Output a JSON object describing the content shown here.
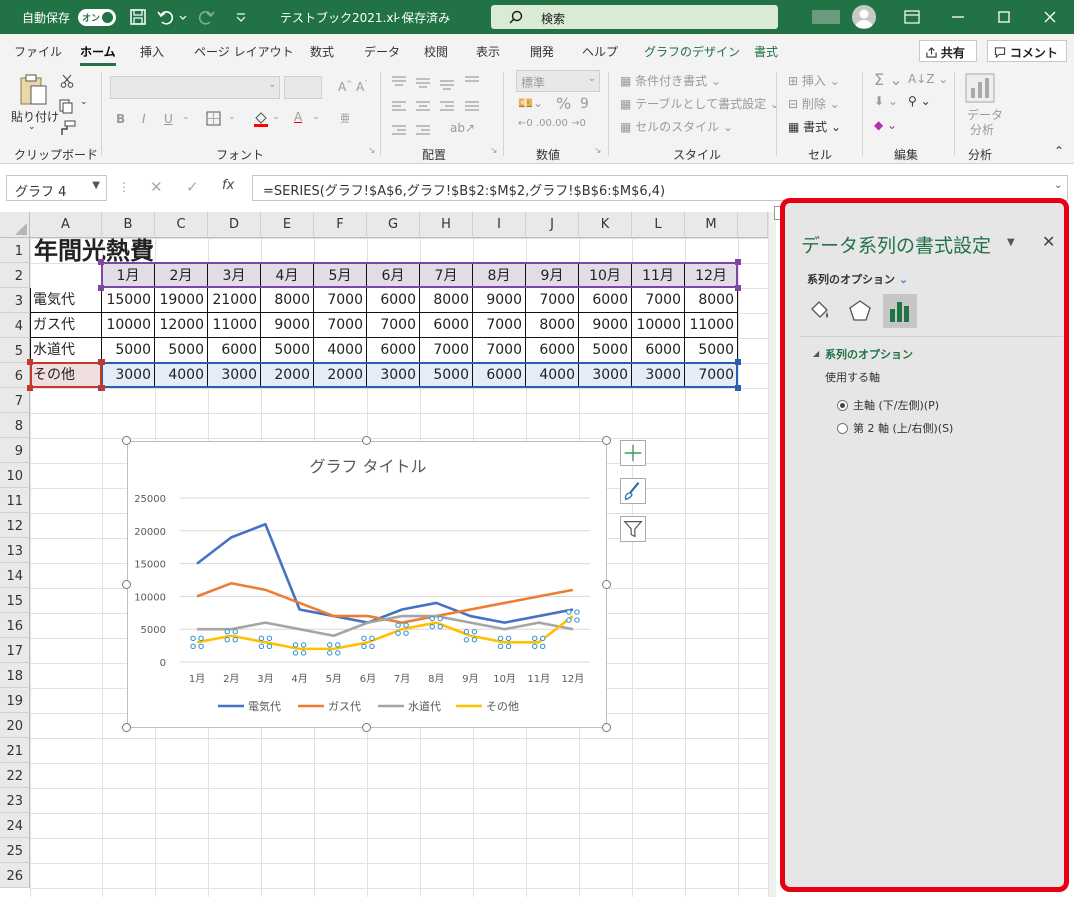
{
  "titlebar": {
    "autosave_label": "自動保存",
    "autosave_state": "オン",
    "filename": "テストブック2021.xl···",
    "save_state": "- 保存済み",
    "search_placeholder": "検索"
  },
  "tabs": [
    "ファイル",
    "ホーム",
    "挿入",
    "ページ レイアウト",
    "数式",
    "データ",
    "校閲",
    "表示",
    "開発",
    "ヘルプ",
    "グラフのデザイン",
    "書式"
  ],
  "tab_active": "ホーム",
  "share_label": "共有",
  "comment_label": "コメント",
  "ribbon": {
    "clipboard": {
      "label": "クリップボード",
      "paste": "貼り付け"
    },
    "font": {
      "label": "フォント"
    },
    "alignment": {
      "label": "配置"
    },
    "number": {
      "label": "数値",
      "format": "標準"
    },
    "styles": {
      "label": "スタイル",
      "conditional": "条件付き書式",
      "as_table": "テーブルとして書式設定",
      "cell_styles": "セルのスタイル"
    },
    "cells": {
      "label": "セル",
      "insert": "挿入",
      "delete": "削除",
      "format": "書式"
    },
    "editing": {
      "label": "編集"
    },
    "analysis": {
      "label": "分析",
      "data_analysis_1": "データ",
      "data_analysis_2": "分析"
    }
  },
  "formula_bar": {
    "name_box": "グラフ 4",
    "formula": "=SERIES(グラフ!$A$6,グラフ!$B$2:$M$2,グラフ!$B$6:$M$6,4)"
  },
  "columns": [
    "A",
    "B",
    "C",
    "D",
    "E",
    "F",
    "G",
    "H",
    "I",
    "J",
    "K",
    "L",
    "M"
  ],
  "rows": [
    "1",
    "2",
    "3",
    "4",
    "5",
    "6",
    "7",
    "8",
    "9",
    "10",
    "11",
    "12",
    "13",
    "14",
    "15",
    "16",
    "17",
    "18",
    "19",
    "20",
    "21",
    "22",
    "23",
    "24",
    "25",
    "26"
  ],
  "sheet": {
    "title": "年間光熱費",
    "months": [
      "1月",
      "2月",
      "3月",
      "4月",
      "5月",
      "6月",
      "7月",
      "8月",
      "9月",
      "10月",
      "11月",
      "12月"
    ],
    "data_rows": [
      {
        "label": "電気代",
        "values": [
          "15000",
          "19000",
          "21000",
          "8000",
          "7000",
          "6000",
          "8000",
          "9000",
          "7000",
          "6000",
          "7000",
          "8000"
        ]
      },
      {
        "label": "ガス代",
        "values": [
          "10000",
          "12000",
          "11000",
          "9000",
          "7000",
          "7000",
          "6000",
          "7000",
          "8000",
          "9000",
          "10000",
          "11000"
        ]
      },
      {
        "label": "水道代",
        "values": [
          "5000",
          "5000",
          "6000",
          "5000",
          "4000",
          "6000",
          "7000",
          "7000",
          "6000",
          "5000",
          "6000",
          "5000"
        ]
      },
      {
        "label": "その他",
        "values": [
          "3000",
          "4000",
          "3000",
          "2000",
          "2000",
          "3000",
          "5000",
          "6000",
          "4000",
          "3000",
          "3000",
          "7000"
        ]
      }
    ]
  },
  "chart_data": {
    "type": "line",
    "title": "グラフ タイトル",
    "categories": [
      "1月",
      "2月",
      "3月",
      "4月",
      "5月",
      "6月",
      "7月",
      "8月",
      "9月",
      "10月",
      "11月",
      "12月"
    ],
    "y_ticks": [
      "0",
      "5000",
      "10000",
      "15000",
      "20000",
      "25000"
    ],
    "ylim": [
      0,
      25000
    ],
    "legend_position": "bottom",
    "series": [
      {
        "name": "電気代",
        "color": "#4472C4",
        "values": [
          15000,
          19000,
          21000,
          8000,
          7000,
          6000,
          8000,
          9000,
          7000,
          6000,
          7000,
          8000
        ]
      },
      {
        "name": "ガス代",
        "color": "#ED7D31",
        "values": [
          10000,
          12000,
          11000,
          9000,
          7000,
          7000,
          6000,
          7000,
          8000,
          9000,
          10000,
          11000
        ]
      },
      {
        "name": "水道代",
        "color": "#A5A5A5",
        "values": [
          5000,
          5000,
          6000,
          5000,
          4000,
          6000,
          7000,
          7000,
          6000,
          5000,
          6000,
          5000
        ]
      },
      {
        "name": "その他",
        "color": "#FFC000",
        "values": [
          3000,
          4000,
          3000,
          2000,
          2000,
          3000,
          5000,
          6000,
          4000,
          3000,
          3000,
          7000
        ]
      }
    ]
  },
  "pane": {
    "title": "データ系列の書式設定",
    "options_dropdown": "系列のオプション",
    "section": "系列のオプション",
    "axis_label": "使用する軸",
    "primary": "主軸 (下/左側)(P)",
    "secondary": "第 2 軸 (上/右側)(S)"
  }
}
